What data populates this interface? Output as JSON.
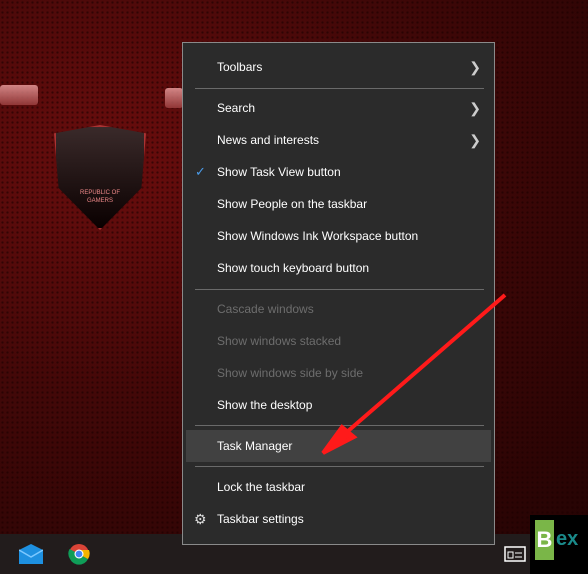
{
  "wallpaper": {
    "logo_text": "REPUBLIC OF GAMERS"
  },
  "context_menu": {
    "items": [
      {
        "label": "Toolbars",
        "submenu": true
      },
      {
        "label": "Search",
        "submenu": true
      },
      {
        "label": "News and interests",
        "submenu": true
      },
      {
        "label": "Show Task View button",
        "checked": true
      },
      {
        "label": "Show People on the taskbar"
      },
      {
        "label": "Show Windows Ink Workspace button"
      },
      {
        "label": "Show touch keyboard button"
      },
      {
        "label": "Cascade windows",
        "disabled": true
      },
      {
        "label": "Show windows stacked",
        "disabled": true
      },
      {
        "label": "Show windows side by side",
        "disabled": true
      },
      {
        "label": "Show the desktop"
      },
      {
        "label": "Task Manager",
        "highlighted": true
      },
      {
        "label": "Lock the taskbar"
      },
      {
        "label": "Taskbar settings",
        "icon": "gear-icon"
      }
    ]
  },
  "taskbar": {
    "icons": [
      "mail-icon",
      "chrome-icon",
      "news-icon"
    ]
  },
  "watermark": {
    "text": "Bex"
  },
  "colors": {
    "accent_check": "#4a9be8",
    "arrow": "#ff1a1a",
    "menu_bg": "#2b2b2b",
    "highlight": "#414141"
  }
}
